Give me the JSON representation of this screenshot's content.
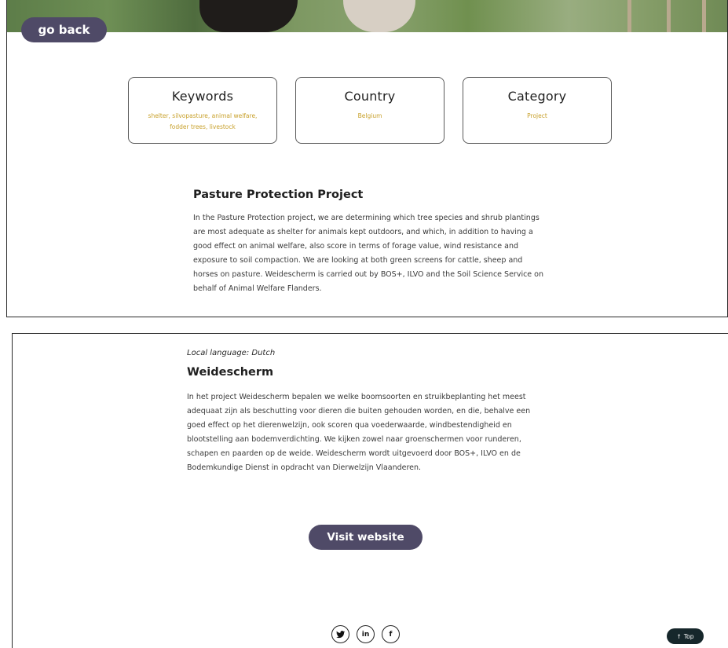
{
  "header": {
    "go_back_label": "go back"
  },
  "cards": [
    {
      "title": "Keywords",
      "value": "shelter, silvopasture, animal welfare, fodder trees, livestock"
    },
    {
      "title": "Country",
      "value": "Belgium"
    },
    {
      "title": "Category",
      "value": "Project"
    }
  ],
  "english": {
    "title": "Pasture Protection Project",
    "paragraph": "In the Pasture Protection project, we are determining which tree species and shrub plantings are most adequate as shelter for animals kept outdoors, and which, in addition to having a good effect on animal welfare, also score in terms of forage value, wind resistance and exposure to soil compaction. We are looking at both green screens for cattle, sheep and horses on pasture. Weidescherm is carried out by BOS+, ILVO and the Soil Science Service on behalf of Animal Welfare Flanders."
  },
  "local": {
    "language_line": "Local language:  Dutch",
    "title": "Weidescherm",
    "paragraph": "In het project Weidescherm bepalen we welke boomsoorten en struikbeplanting het meest adequaat zijn als beschutting voor dieren die buiten gehouden worden, en die, behalve een goed effect op het dierenwelzijn, ook scoren qua voederwaarde, windbestendigheid en blootstelling aan bodemverdichting. We kijken zowel naar groenschermen voor runderen, schapen en paarden op de weide. Weidescherm wordt uitgevoerd door BOS+, ILVO en de Bodemkundige Dienst in opdracht van Dierwelzijn Vlaanderen."
  },
  "actions": {
    "visit_label": "Visit website",
    "top_label": "Top"
  },
  "social": {
    "linkedin_label": "in",
    "facebook_label": "f"
  },
  "icons": [
    "twitter-icon",
    "linkedin-icon",
    "facebook-icon",
    "arrow-up-icon"
  ],
  "colors": {
    "button": "#4f4a67",
    "accent": "#c8a12c",
    "top_button": "#16272b"
  }
}
